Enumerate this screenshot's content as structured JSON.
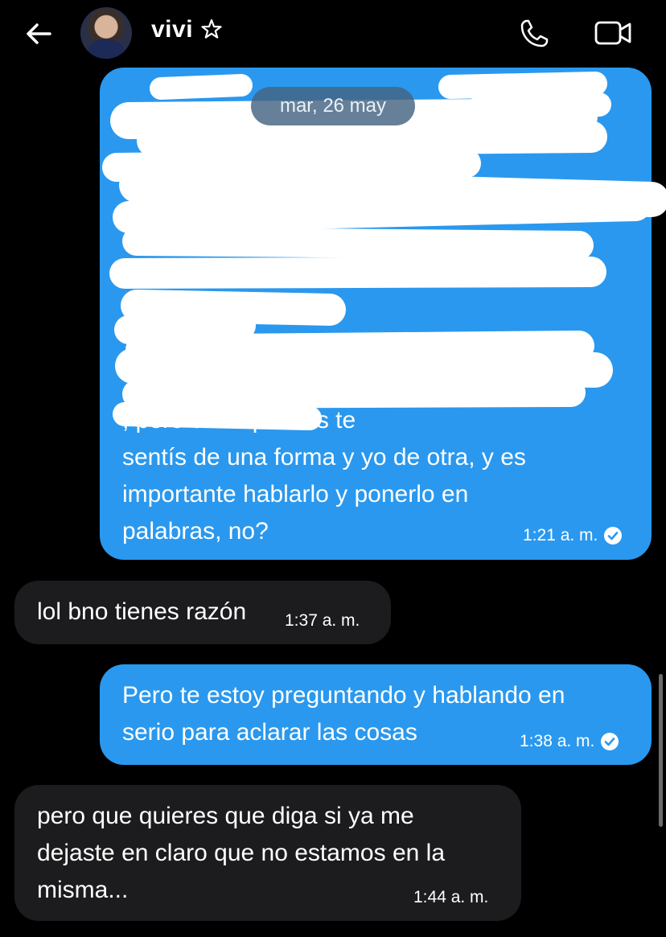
{
  "header": {
    "back_icon": "back-arrow-icon",
    "contact_name": "vivi",
    "star_icon": "star-outline-icon",
    "call_icon": "phone-icon",
    "video_icon": "video-camera-icon"
  },
  "date_separator": "mar, 26 may",
  "messages": [
    {
      "direction": "outgoing",
      "visible_text": ", pero creo que vos te\nsentís de una forma y yo de otra, y es\nimportante hablarlo y ponerlo en\npalabras, no?",
      "time": "1:21 a. m.",
      "status_icon": "read-check-icon",
      "redacted": true
    },
    {
      "direction": "incoming",
      "text": "lol bno tienes razón",
      "time": "1:37 a. m."
    },
    {
      "direction": "outgoing",
      "text": "Pero te estoy preguntando y hablando en\nserio para aclarar las cosas",
      "time": "1:38 a. m.",
      "status_icon": "read-check-icon"
    },
    {
      "direction": "incoming",
      "text": "pero que quieres que diga si ya me\ndejaste en claro que no estamos en la\nmisma...",
      "time": "1:44 a. m."
    }
  ],
  "colors": {
    "background": "#000000",
    "outgoing_bubble": "#2a98ee",
    "incoming_bubble": "#1c1c1e",
    "redaction": "#ffffff"
  }
}
